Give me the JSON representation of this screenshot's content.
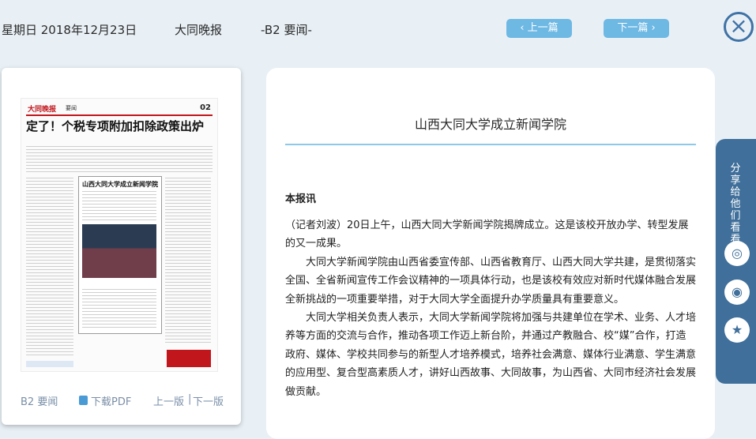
{
  "header": {
    "date": "星期日 2018年12月23日",
    "paper_name": "大同晚报",
    "section": "-B2 要闻-",
    "prev_label": "上一篇",
    "next_label": "下一篇",
    "prev_icon": "chevron-left-icon",
    "next_icon": "chevron-right-icon",
    "close_icon": "close-icon"
  },
  "page_thumb": {
    "logo": "大同晚报",
    "section": "要闻",
    "page_number": "02",
    "headline": "定了！个税专项附加扣除政策出炉",
    "box_headline": "山西大同大学成立新闻学院"
  },
  "left_footer": {
    "page_label": "B2 要闻",
    "pdf_label": "下载PDF",
    "prev_page": "上一版",
    "separator": "|",
    "next_page": "下一版"
  },
  "article": {
    "title": "山西大同大学成立新闻学院",
    "lead": "本报讯",
    "paragraphs": [
      "（记者刘波）20日上午，山西大同大学新闻学院揭牌成立。这是该校开放办学、转型发展的又一成果。",
      "大同大学新闻学院由山西省委宣传部、山西省教育厅、山西大同大学共建，是贯彻落实全国、全省新闻宣传工作会议精神的一项具体行动，也是该校有效应对新时代媒体融合发展全新挑战的一项重要举措，对于大同大学全面提升办学质量具有重要意义。",
      "大同大学相关负责人表示，大同大学新闻学院将加强与共建单位在学术、业务、人才培养等方面的交流与合作，推动各项工作迈上新台阶，并通过产教融合、校“媒”合作，打造政府、媒体、学校共同参与的新型人才培养模式，培养社会满意、媒体行业满意、学生满意的应用型、复合型高素质人才，讲好山西故事、大同故事，为山西省、大同市经济社会发展做贡献。"
    ]
  },
  "share": {
    "label": "分享给他们看看",
    "items": [
      {
        "icon": "wechat-icon",
        "glyph": "◎"
      },
      {
        "icon": "weibo-icon",
        "glyph": "◉"
      },
      {
        "icon": "favorite-star-icon",
        "glyph": "★"
      }
    ]
  },
  "colors": {
    "background": "#e8f0f6",
    "nav_button": "#6eb8e4",
    "close": "#3f72a5",
    "share_bar": "#3f6f9a",
    "title_rule": "#8ec9e8"
  }
}
